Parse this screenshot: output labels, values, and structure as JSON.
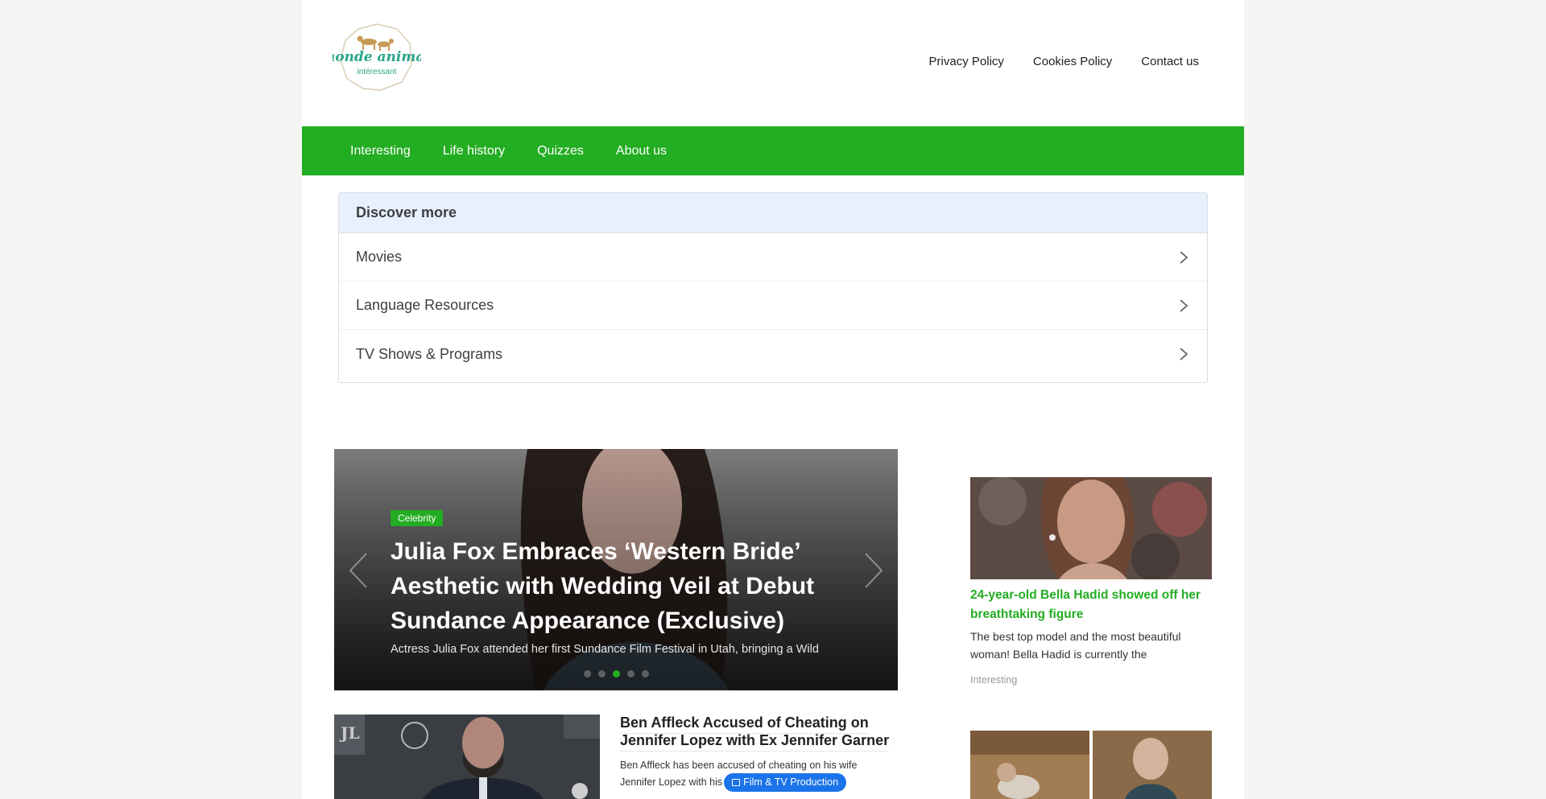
{
  "header": {
    "logo_text_top": "monde animal",
    "logo_text_bottom": "intéressant",
    "links": [
      "Privacy Policy",
      "Cookies Policy",
      "Contact us"
    ]
  },
  "mainnav": {
    "items": [
      "Interesting",
      "Life history",
      "Quizzes",
      "About us"
    ],
    "color": "#23ad22"
  },
  "discover": {
    "title": "Discover more",
    "items": [
      "Movies",
      "Language Resources",
      "TV Shows & Programs"
    ]
  },
  "slider": {
    "badge": "Celebrity",
    "title": "Julia Fox Embraces ‘Western Bride’ Aesthetic with Wedding Veil at Debut Sundance Appearance (Exclusive)",
    "excerpt": "Actress Julia Fox attended her first Sundance Film Festival in Utah, bringing a Wild",
    "slide_count": 5,
    "active_index": 2
  },
  "article": {
    "title": "Ben Affleck Accused of Cheating on Jennifer Lopez with Ex Jennifer Garner",
    "excerpt_line1": "Ben Affleck has been accused of cheating on his wife",
    "excerpt_line2": "Jennifer Lopez with his",
    "chip": "Film & TV Production"
  },
  "sidebar": {
    "title": "24-year-old Bella Hadid showed off her breathtaking figure",
    "excerpt": "The best top model and the most beautiful woman! Bella Hadid is currently the",
    "category": "Interesting"
  }
}
